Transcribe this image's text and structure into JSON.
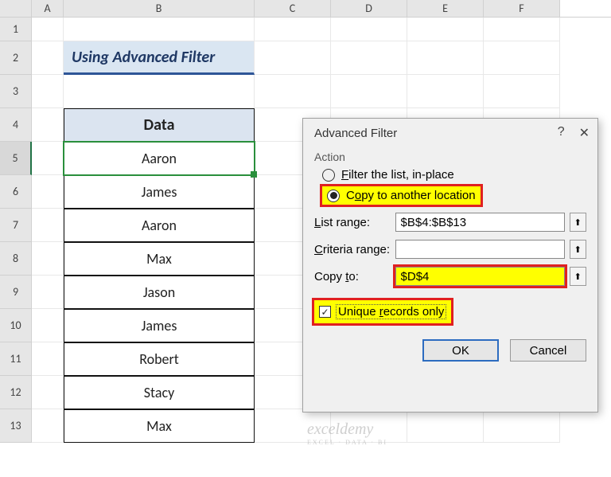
{
  "columns": [
    "A",
    "B",
    "C",
    "D",
    "E",
    "F"
  ],
  "rows": [
    "1",
    "2",
    "3",
    "4",
    "5",
    "6",
    "7",
    "8",
    "9",
    "10",
    "11",
    "12",
    "13"
  ],
  "title_cell": "Using Advanced Filter",
  "table": {
    "header": "Data",
    "values": [
      "Aaron",
      "James",
      "Aaron",
      "Max",
      "Jason",
      "James",
      "Robert",
      "Stacy",
      "Max"
    ]
  },
  "dialog": {
    "title": "Advanced Filter",
    "help_char": "?",
    "close_char": "✕",
    "action_label": "Action",
    "radio_inplace": "Filter the list, in-place",
    "radio_copy": "Copy to another location",
    "list_range_label": "List range:",
    "list_range_value": "$B$4:$B$13",
    "criteria_label": "Criteria range:",
    "criteria_value": "",
    "copyto_label": "Copy to:",
    "copyto_value": "$D$4",
    "unique_label": "Unique records only",
    "ok": "OK",
    "cancel": "Cancel",
    "ref_icon": "⬆"
  },
  "watermark": "exceldemy",
  "watermark_sub": "EXCEL · DATA · BI"
}
